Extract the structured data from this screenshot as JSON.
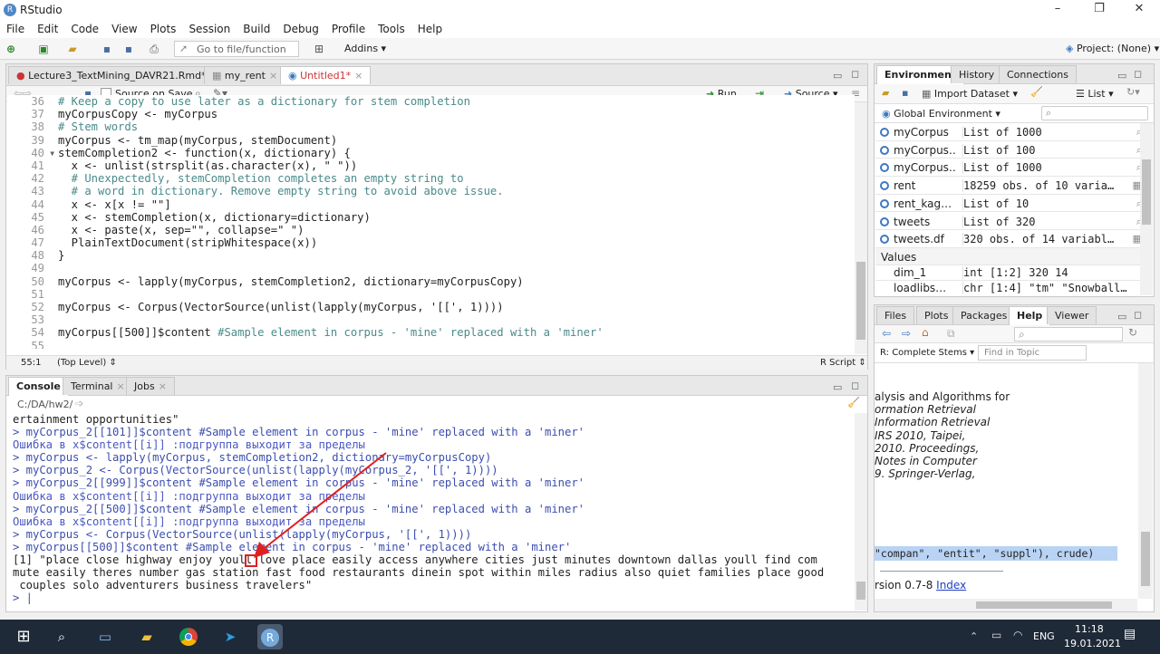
{
  "window": {
    "title": "RStudio",
    "controls": [
      "–",
      "❐",
      "✕"
    ]
  },
  "menu": [
    "File",
    "Edit",
    "Code",
    "View",
    "Plots",
    "Session",
    "Build",
    "Debug",
    "Profile",
    "Tools",
    "Help"
  ],
  "toolbar": {
    "goto_placeholder": "Go to file/function",
    "addins": "Addins",
    "project": "Project: (None)"
  },
  "editor": {
    "tabs": [
      "Lecture3_TextMining_DAVR21.Rmd*",
      "my_rent",
      "Untitled1*"
    ],
    "source_on_save": "Source on Save",
    "run": "Run",
    "source": "Source",
    "lines": [
      {
        "n": "36",
        "t": "# Keep a copy to use later as a dictionary for stem completion",
        "k": "cm"
      },
      {
        "n": "37",
        "t": "myCorpusCopy <- myCorpus",
        "k": ""
      },
      {
        "n": "38",
        "t": "# Stem words",
        "k": "cm"
      },
      {
        "n": "39",
        "t": "myCorpus <- tm_map(myCorpus, stemDocument)",
        "k": ""
      },
      {
        "n": "40",
        "t": "stemCompletion2 <- function(x, dictionary) {",
        "k": "",
        "fold": "▾"
      },
      {
        "n": "41",
        "t": "  x <- unlist(strsplit(as.character(x), \" \"))",
        "k": ""
      },
      {
        "n": "42",
        "t": "  # Unexpectedly, stemCompletion completes an empty string to",
        "k": "cm"
      },
      {
        "n": "43",
        "t": "  # a word in dictionary. Remove empty string to avoid above issue.",
        "k": "cm"
      },
      {
        "n": "44",
        "t": "  x <- x[x != \"\"]",
        "k": ""
      },
      {
        "n": "45",
        "t": "  x <- stemCompletion(x, dictionary=dictionary)",
        "k": ""
      },
      {
        "n": "46",
        "t": "  x <- paste(x, sep=\"\", collapse=\" \")",
        "k": ""
      },
      {
        "n": "47",
        "t": "  PlainTextDocument(stripWhitespace(x))",
        "k": ""
      },
      {
        "n": "48",
        "t": "}",
        "k": ""
      },
      {
        "n": "49",
        "t": "",
        "k": ""
      },
      {
        "n": "50",
        "t": "myCorpus <- lapply(myCorpus, stemCompletion2, dictionary=myCorpusCopy)",
        "k": ""
      },
      {
        "n": "51",
        "t": "",
        "k": ""
      },
      {
        "n": "52",
        "t": "myCorpus <- Corpus(VectorSource(unlist(lapply(myCorpus, '[[', 1))))",
        "k": ""
      },
      {
        "n": "53",
        "t": "",
        "k": ""
      },
      {
        "n": "54",
        "t": "myCorpus[[500]]$content #Sample element in corpus - 'mine' replaced with a 'miner'",
        "k": "mix"
      },
      {
        "n": "55",
        "t": "",
        "k": ""
      }
    ],
    "status_pos": "55:1",
    "status_level": "(Top Level)",
    "status_type": "R Script"
  },
  "console": {
    "tabs": [
      "Console",
      "Terminal",
      "Jobs"
    ],
    "path": "C:/DA/hw2/",
    "lines": [
      {
        "t": "ertainment opportunities\"",
        "k": "out"
      },
      {
        "t": "> myCorpus_2[[101]]$content #Sample element in corpus - 'mine' replaced with a 'miner'",
        "k": "cmd"
      },
      {
        "t": "Ошибка в x$content[[i]] :подгруппа выходит за пределы",
        "k": "err"
      },
      {
        "t": "> myCorpus <- lapply(myCorpus, stemCompletion2, dictionary=myCorpusCopy)",
        "k": "cmd"
      },
      {
        "t": "> myCorpus_2 <- Corpus(VectorSource(unlist(lapply(myCorpus_2, '[[', 1))))",
        "k": "cmd"
      },
      {
        "t": "> myCorpus_2[[999]]$content #Sample element in corpus - 'mine' replaced with a 'miner'",
        "k": "cmd"
      },
      {
        "t": "Ошибка в x$content[[i]] :подгруппа выходит за пределы",
        "k": "err"
      },
      {
        "t": "> myCorpus_2[[500]]$content #Sample element in corpus - 'mine' replaced with a 'miner'",
        "k": "cmd"
      },
      {
        "t": "Ошибка в x$content[[i]] :подгруппа выходит за пределы",
        "k": "err"
      },
      {
        "t": "> myCorpus <- Corpus(VectorSource(unlist(lapply(myCorpus, '[[', 1))))",
        "k": "cmd"
      },
      {
        "t": "> myCorpus[[500]]$content #Sample element in corpus - 'mine' replaced with a 'miner'",
        "k": "cmd"
      },
      {
        "t": "[1] \"place close highway enjoy youll love place easily access anywhere cities just minutes downtown dallas youll find com",
        "k": "out"
      },
      {
        "t": "mute easily theres number gas station fast food restaurants dinein spot within miles radius also quiet families place good",
        "k": "out"
      },
      {
        "t": " couples solo adventurers business travelers\"",
        "k": "out"
      },
      {
        "t": "> |",
        "k": "prompt"
      }
    ]
  },
  "environment": {
    "tabs": [
      "Environment",
      "History",
      "Connections"
    ],
    "import_label": "Import Dataset",
    "list_label": "List",
    "scope": "Global Environment",
    "rows": [
      {
        "name": "myCorpus",
        "value": "List of 1000",
        "icon": "search-icon"
      },
      {
        "name": "myCorpus…",
        "value": "List of 100",
        "icon": "search-icon"
      },
      {
        "name": "myCorpus…",
        "value": "List of 1000",
        "icon": "search-icon"
      },
      {
        "name": "rent",
        "value": "18259 obs. of 10 varia…",
        "icon": "table-icon"
      },
      {
        "name": "rent_kag…",
        "value": "List of 10",
        "icon": "search-icon"
      },
      {
        "name": "tweets",
        "value": "List of 320",
        "icon": "search-icon"
      },
      {
        "name": "tweets.df",
        "value": "320 obs. of 14 variabl…",
        "icon": "table-icon"
      }
    ],
    "values_header": "Values",
    "values": [
      {
        "name": "dim_1",
        "value": "int [1:2] 320 14"
      },
      {
        "name": "loadlibs…",
        "value": "chr [1:4] \"tm\" \"Snowball…"
      }
    ]
  },
  "help": {
    "tabs": [
      "Files",
      "Plots",
      "Packages",
      "Help",
      "Viewer"
    ],
    "topic": "R: Complete Stems",
    "find_placeholder": "Find in Topic",
    "lines": [
      "alysis and Algorithms for",
      "ormation Retrieval",
      "Information Retrieval",
      "IRS 2010, Taipei,",
      "2010. Proceedings,",
      "Notes in Computer",
      "9. Springer-Verlag,"
    ],
    "selected_code": "\"compan\", \"entit\", \"suppl\"), crude)",
    "version_text": "rsion 0.7-8 ",
    "index_link": "Index"
  },
  "taskbar": {
    "time": "11:18",
    "date": "19.01.2021",
    "lang": "ENG"
  },
  "colors": {
    "accent": "#3d79c0",
    "error": "#4a58c2",
    "arrow": "#e02020"
  }
}
